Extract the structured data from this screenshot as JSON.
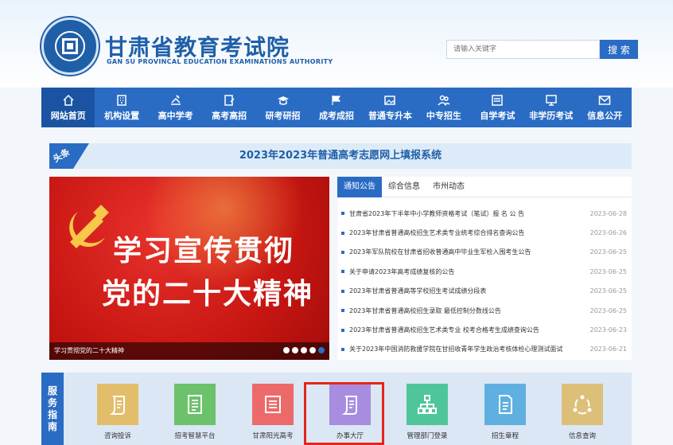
{
  "header": {
    "title": "甘肃省教育考试院",
    "subtitle": "GAN SU PROVINCAL EDUCATION EXAMINATIONS AUTHORITY",
    "seal_text": "甘肃省教育考试院",
    "search": {
      "placeholder": "请输入关键字",
      "button_label": "搜 索"
    }
  },
  "nav": {
    "items": [
      {
        "label": "网站首页",
        "icon": "home-icon",
        "active": true
      },
      {
        "label": "机构设置",
        "icon": "building-icon"
      },
      {
        "label": "高中学考",
        "icon": "book-pen-icon"
      },
      {
        "label": "高考高招",
        "icon": "edit-doc-icon"
      },
      {
        "label": "研考研招",
        "icon": "graduation-cap-icon"
      },
      {
        "label": "成考成招",
        "icon": "flag-icon"
      },
      {
        "label": "普通专升本",
        "icon": "image-doc-icon"
      },
      {
        "label": "中专招生",
        "icon": "people-icon"
      },
      {
        "label": "自学考试",
        "icon": "list-box-icon"
      },
      {
        "label": "非学历考试",
        "icon": "monitor-icon"
      },
      {
        "label": "信息公开",
        "icon": "mail-icon"
      }
    ]
  },
  "headline": {
    "tag": "头条",
    "text": "2023年2023年普通高考志愿网上填报系统"
  },
  "slide": {
    "line1": "学习宣传贯彻",
    "line2": "党的二十大精神",
    "caption": "学习贯彻党的二十大精神",
    "dot_count": 5,
    "active_dot": 4
  },
  "news": {
    "tabs": [
      "通知公告",
      "综合信息",
      "市州动态"
    ],
    "active_tab": 0,
    "items": [
      {
        "title": "甘肃省2023年下半年中小学教师资格考试（笔试）报 名 公 告",
        "date": "2023-06-28"
      },
      {
        "title": "2023年甘肃省普通高校招生艺术类专业统考综合排名查询公告",
        "date": "2023-06-26"
      },
      {
        "title": "2023年军队院校在甘肃省招收普通高中毕业生军检入围考生公告",
        "date": "2023-06-25"
      },
      {
        "title": "关于申请2023年高考成绩复核的公告",
        "date": "2023-06-25"
      },
      {
        "title": "2023年甘肃省普通高等学校招生考试成绩分段表",
        "date": "2023-06-25"
      },
      {
        "title": "2023年甘肃省普通高校招生录取 最低控制分数线公告",
        "date": "2023-06-25"
      },
      {
        "title": "2023年甘肃省普通高校招生艺术类专业 校考合格考生成绩查询公告",
        "date": "2023-06-23"
      },
      {
        "title": "关于2023年中国消防救援学院在甘招收青年学生政治考核体检心理测试面试",
        "date": "2023-06-21"
      }
    ]
  },
  "services": {
    "label": [
      "服",
      "务",
      "指",
      "南"
    ],
    "items": [
      {
        "label": "咨询投诉",
        "icon": "scroll-icon",
        "color": "#e2bd6a"
      },
      {
        "label": "招考智慧平台",
        "icon": "document-list-icon",
        "color": "#6cc26a"
      },
      {
        "label": "甘肃阳光高考",
        "icon": "list-doc-icon",
        "color": "#ec6a6a"
      },
      {
        "label": "办事大厅",
        "icon": "scroll-icon",
        "color": "#a78ce0"
      },
      {
        "label": "管理部门登录",
        "icon": "org-chart-icon",
        "color": "#4fc69a"
      },
      {
        "label": "招生章程",
        "icon": "document-icon",
        "color": "#5fb0e0"
      },
      {
        "label": "信息查询",
        "icon": "cycle-icon",
        "color": "#dcc07a"
      }
    ]
  },
  "colors": {
    "primary": "#2a6cc4",
    "nav_active": "#1b53a3",
    "highlight": "#e3261b"
  }
}
